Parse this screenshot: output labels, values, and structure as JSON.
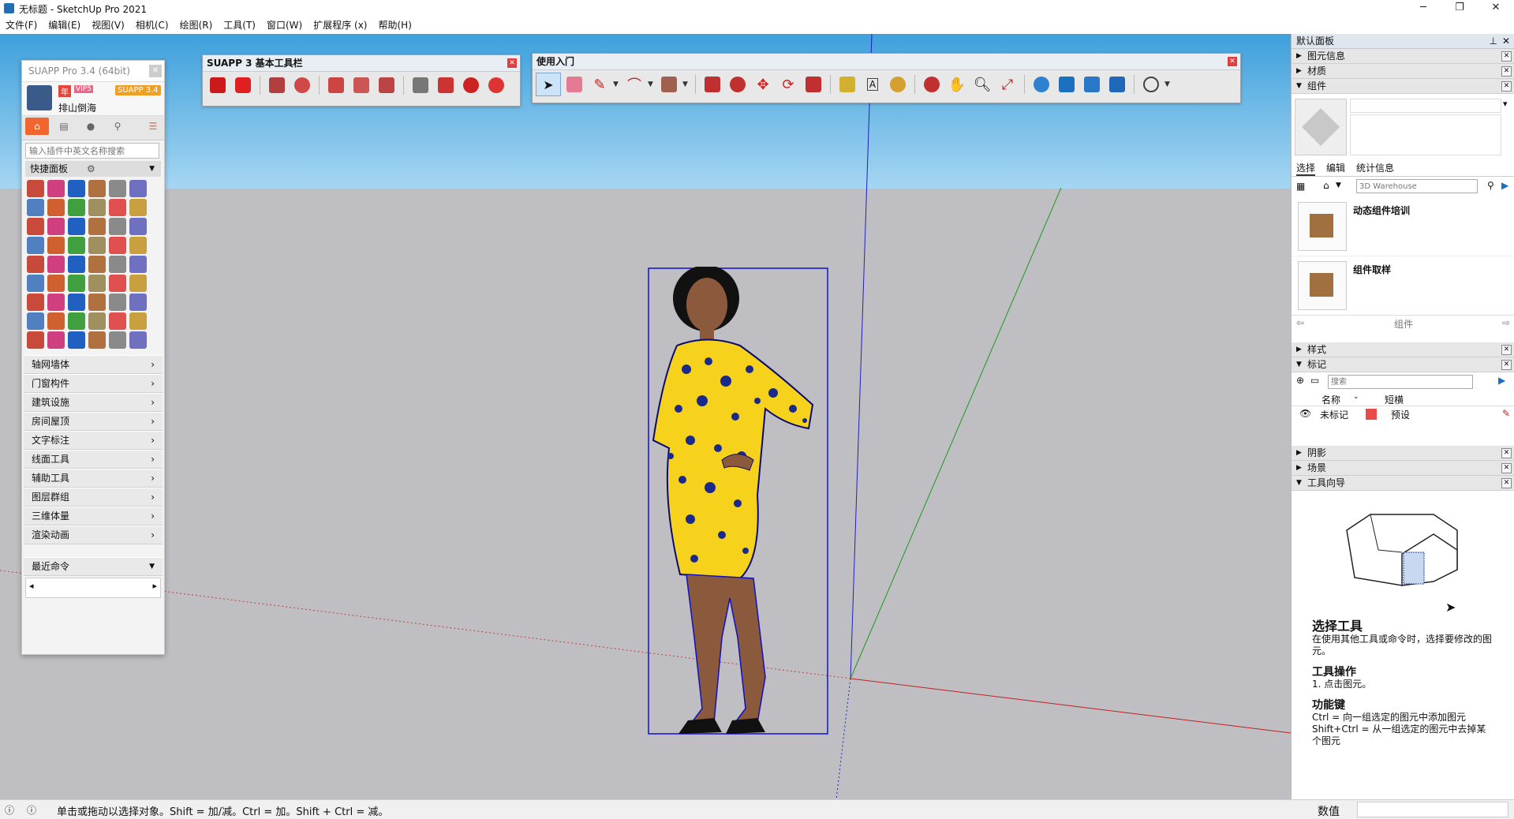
{
  "window": {
    "title": "无标题 - SketchUp Pro 2021",
    "minimize": "─",
    "maximize": "❐",
    "close": "✕"
  },
  "menu": [
    "文件(F)",
    "编辑(E)",
    "视图(V)",
    "相机(C)",
    "绘图(R)",
    "工具(T)",
    "窗口(W)",
    "扩展程序 (x)",
    "帮助(H)"
  ],
  "toolbar_suapp": {
    "title": "SUAPP 3 基本工具栏"
  },
  "toolbar_start": {
    "title": "使用入门"
  },
  "suapp_panel": {
    "title": "SUAPP Pro 3.4 (64bit)",
    "user_name": "排山倒海",
    "badge_year": "年",
    "badge_vip": "VIP5",
    "badge_version": "SUAPP 3.4",
    "search_placeholder": "输入插件中英文名称搜索",
    "quick_panel": "快捷面板",
    "categories": [
      "轴网墙体",
      "门窗构件",
      "建筑设施",
      "房间屋顶",
      "文字标注",
      "线面工具",
      "辅助工具",
      "图层群组",
      "三维体量",
      "渲染动画"
    ],
    "recent": "最近命令",
    "left_arrow": "◂",
    "right_arrow": "▸"
  },
  "right_panel": {
    "tray_title": "默认面板",
    "sections_top": [
      "图元信息",
      "材质",
      "组件"
    ],
    "component_tabs": [
      "选择",
      "编辑",
      "统计信息"
    ],
    "warehouse_search": "3D Warehouse",
    "components": [
      "动态组件培训",
      "组件取样"
    ],
    "components_footer": "组件",
    "styles": "样式",
    "tags": "标记",
    "tags_search": "搜索",
    "tags_cols": {
      "name": "名称",
      "dash": "短横"
    },
    "tags_row": {
      "name": "未标记",
      "dash": "预设",
      "color": "#e84a4a"
    },
    "sections_bottom": [
      "阴影",
      "场景",
      "工具向导"
    ],
    "instructor": {
      "tool_title": "选择工具",
      "tool_desc": "在使用其他工具或命令时，选择要修改的图元。",
      "ops_title": "工具操作",
      "ops_1": "1. 点击图元。",
      "keys_title": "功能键",
      "keys_1": "Ctrl = 向一组选定的图元中添加图元",
      "keys_2": "Shift+Ctrl = 从一组选定的图元中去掉某个图元"
    }
  },
  "status": {
    "message": "单击或拖动以选择对象。Shift = 加/减。Ctrl = 加。Shift + Ctrl = 减。",
    "measure_label": "数值"
  }
}
